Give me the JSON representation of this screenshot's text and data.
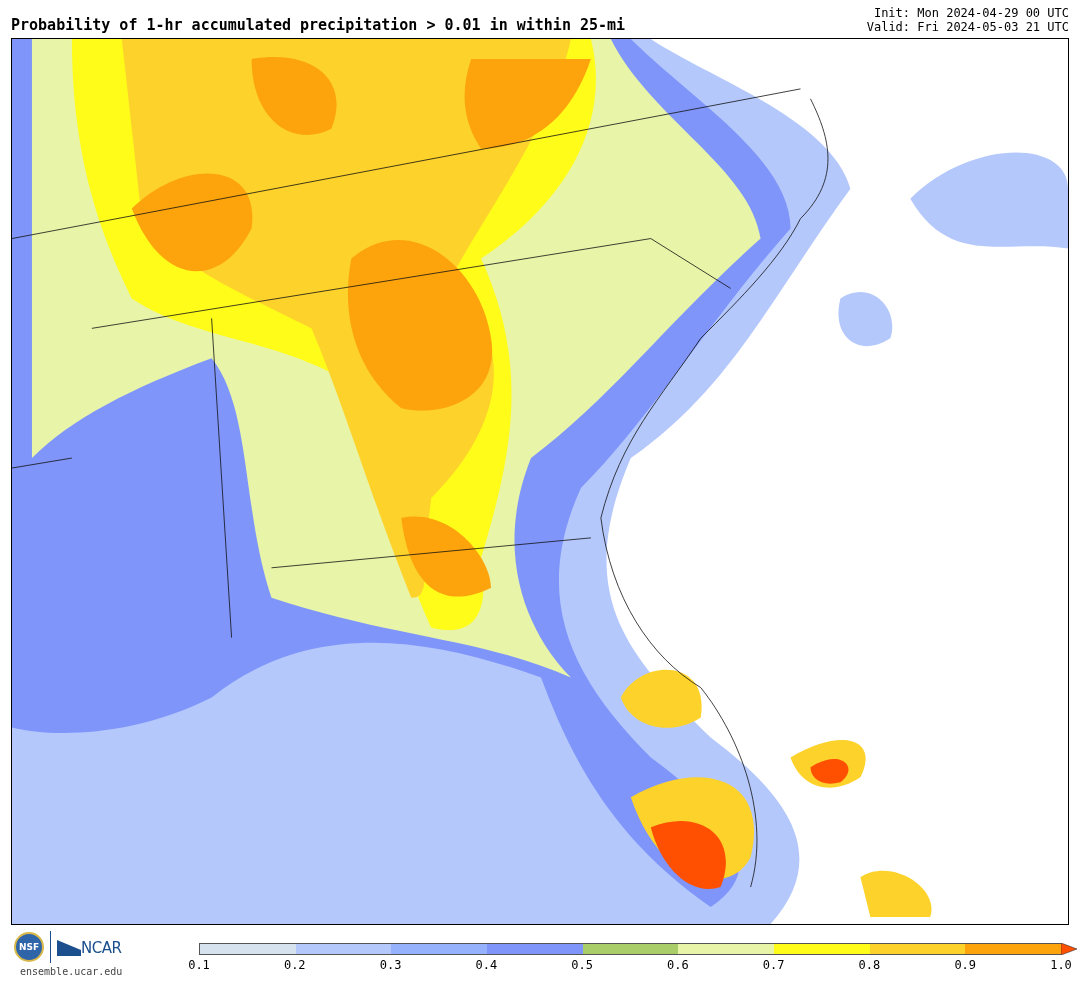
{
  "title": "Probability of 1-hr accumulated precipitation > 0.01 in within 25-mi",
  "init": "Init: Mon 2024-04-29 00 UTC",
  "valid": "Valid: Fri 2024-05-03 21 UTC",
  "logos": {
    "nsf": "NSF",
    "ncar": "NCAR",
    "url": "ensemble.ucar.edu"
  },
  "colorbar": {
    "segments": [
      {
        "color": "#d6e2ee"
      },
      {
        "color": "#b4c8fc"
      },
      {
        "color": "#97b2fc"
      },
      {
        "color": "#7f95fa"
      },
      {
        "color": "#a9cd68"
      },
      {
        "color": "#e8f4a8"
      },
      {
        "color": "#fffc1a"
      },
      {
        "color": "#fdd22a"
      },
      {
        "color": "#fda40c"
      }
    ],
    "extend": {
      "color": "#fe5000"
    },
    "ticks": [
      "0.1",
      "0.2",
      "0.3",
      "0.4",
      "0.5",
      "0.6",
      "0.7",
      "0.8",
      "0.9",
      "1.0"
    ]
  }
}
